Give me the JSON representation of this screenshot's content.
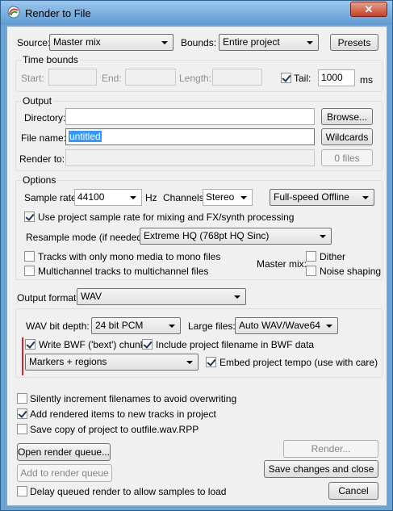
{
  "window": {
    "title": "Render to File",
    "close": "✕"
  },
  "top": {
    "source_label": "Source:",
    "source_value": "Master mix",
    "bounds_label": "Bounds:",
    "bounds_value": "Entire project",
    "presets": "Presets"
  },
  "time_bounds": {
    "title": "Time bounds",
    "start": "Start:",
    "end": "End:",
    "length": "Length:",
    "tail": "Tail:",
    "tail_value": "1000",
    "unit": "ms",
    "tail_checked": true
  },
  "output": {
    "title": "Output",
    "directory": "Directory:",
    "browse": "Browse...",
    "filename": "File name:",
    "filename_value": "untitled",
    "wildcards": "Wildcards",
    "render_to": "Render to:",
    "files": "0 files"
  },
  "options": {
    "title": "Options",
    "sample_rate": "Sample rate:",
    "sample_rate_value": "44100",
    "hz": "Hz",
    "channels": "Channels:",
    "channels_value": "Stereo",
    "speed": "Full-speed Offline",
    "use_project_rate": "Use project sample rate for mixing and FX/synth processing",
    "resample": "Resample mode (if needed):",
    "resample_value": "Extreme HQ (768pt HQ Sinc)",
    "mono": "Tracks with only mono media to mono files",
    "multichannel": "Multichannel tracks to multichannel files",
    "master_mix": "Master mix:",
    "dither": "Dither",
    "noise_shaping": "Noise shaping"
  },
  "format": {
    "output_format": "Output format:",
    "format_value": "WAV",
    "bit_depth": "WAV bit depth:",
    "bit_depth_value": "24 bit PCM",
    "large_files": "Large files:",
    "large_files_value": "Auto WAV/Wave64",
    "bwf": "Write BWF ('bext') chunk",
    "include_filename": "Include project filename in BWF data",
    "markers_value": "Markers + regions",
    "embed_tempo": "Embed project tempo (use with care)"
  },
  "bottom": {
    "silently": "Silently increment filenames to avoid overwriting",
    "add_rendered": "Add rendered items to new tracks in project",
    "save_copy": "Save copy of project to outfile.wav.RPP",
    "open_queue": "Open render queue...",
    "render": "Render...",
    "add_queue": "Add to render queue",
    "save_close": "Save changes and close",
    "delay": "Delay queued render to allow samples to load",
    "cancel": "Cancel"
  },
  "colors": {
    "accent_bar": "#e02020",
    "selection": "#3399ff"
  }
}
